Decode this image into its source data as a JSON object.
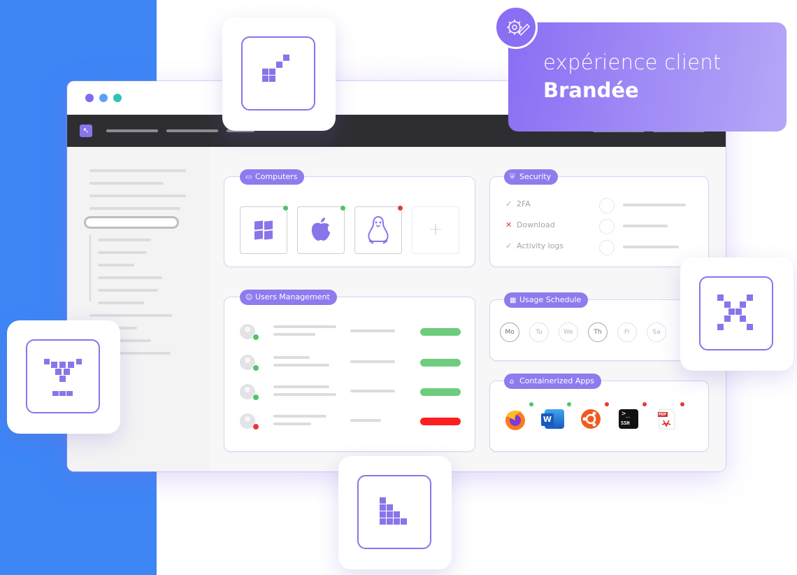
{
  "banner": {
    "line1": "expérience client",
    "line2": "Brandée"
  },
  "app": {
    "logo_glyph": "↖",
    "window_dot_colors": [
      "#7b6cf0",
      "#5fa0f7",
      "#2fc2b8"
    ]
  },
  "panels": {
    "computers": {
      "title": "Computers",
      "icon": "monitor-icon",
      "systems": [
        {
          "name": "windows",
          "status_color": "#4cc46a"
        },
        {
          "name": "apple",
          "status_color": "#4cc46a"
        },
        {
          "name": "linux",
          "status_color": "#e53935"
        }
      ],
      "add_glyph": "+"
    },
    "security": {
      "title": "Security",
      "icon": "shield-icon",
      "rows": [
        {
          "mark": "✓",
          "label": "2FA",
          "mark_color": "#7cc88c"
        },
        {
          "mark": "✕",
          "label": "Download",
          "mark_color": "#e53935"
        },
        {
          "mark": "✓",
          "label": "Activity logs",
          "mark_color": "#7cc88c"
        }
      ]
    },
    "users": {
      "title": "Users Management",
      "icon": "users-icon",
      "rows": [
        {
          "status_color": "#4cc46a",
          "bar_color": "#6dcc7d"
        },
        {
          "status_color": "#4cc46a",
          "bar_color": "#6dcc7d"
        },
        {
          "status_color": "#4cc46a",
          "bar_color": "#6dcc7d"
        },
        {
          "status_color": "#e53935",
          "bar_color": "#ff1f1f"
        }
      ]
    },
    "schedule": {
      "title": "Usage Schedule",
      "icon": "calendar-icon",
      "days": [
        {
          "label": "Mo",
          "active": true
        },
        {
          "label": "Tu",
          "active": false
        },
        {
          "label": "We",
          "active": false
        },
        {
          "label": "Th",
          "active": true
        },
        {
          "label": "Fr",
          "active": false
        },
        {
          "label": "Sa",
          "active": false
        }
      ]
    },
    "apps": {
      "title": "Containerized Apps",
      "icon": "box-icon",
      "items": [
        {
          "name": "firefox",
          "status_color": "#4cc46a"
        },
        {
          "name": "word",
          "status_color": "#4cc46a",
          "glyph": "W"
        },
        {
          "name": "ubuntu",
          "status_color": "#e53935"
        },
        {
          "name": "ssh-terminal",
          "status_color": "#e53935",
          "glyph": "SSH"
        },
        {
          "name": "pdf",
          "status_color": "#e53935",
          "glyph": "PDF"
        }
      ]
    }
  },
  "colors": {
    "accent": "#8a74ea",
    "brand_blue": "#3d86f6",
    "topbar": "#2e2e32"
  }
}
